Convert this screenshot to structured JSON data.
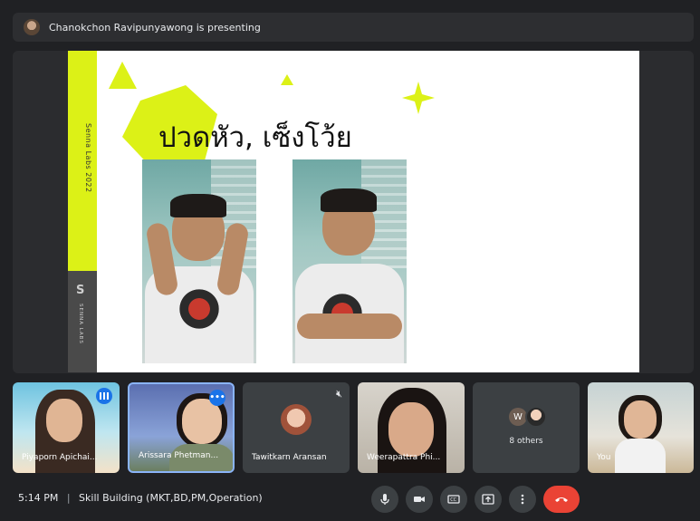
{
  "header": {
    "presenting_text": "Chanokchon Ravipunyawong is presenting"
  },
  "slide": {
    "side_text": "Senna Labs 2022",
    "logo_text": "SENNA LABS",
    "title": "ปวดหัว, เซ็งโว้ย",
    "accent_color": "#dcf117"
  },
  "participants": [
    {
      "name": "Piyaporn Apichai...",
      "speaking": true
    },
    {
      "name": "Arissara Phetman...",
      "more": true
    },
    {
      "name": "Tawitkarn Aransan",
      "muted": true
    },
    {
      "name": "Weerapattra Phi..."
    },
    {
      "name": "8 others",
      "avatar_letter": "W"
    },
    {
      "name": "You"
    }
  ],
  "footer": {
    "time": "5:14 PM",
    "separator": "|",
    "meeting_title": "Skill Building (MKT,BD,PM,Operation)"
  },
  "controls": {
    "icons": [
      "mic-icon",
      "camera-icon",
      "captions-icon",
      "present-icon",
      "more-options-icon",
      "hang-up-icon"
    ]
  },
  "colors": {
    "hangup": "#ea4335",
    "active_speaker": "#1a73e8",
    "background": "#202124"
  }
}
